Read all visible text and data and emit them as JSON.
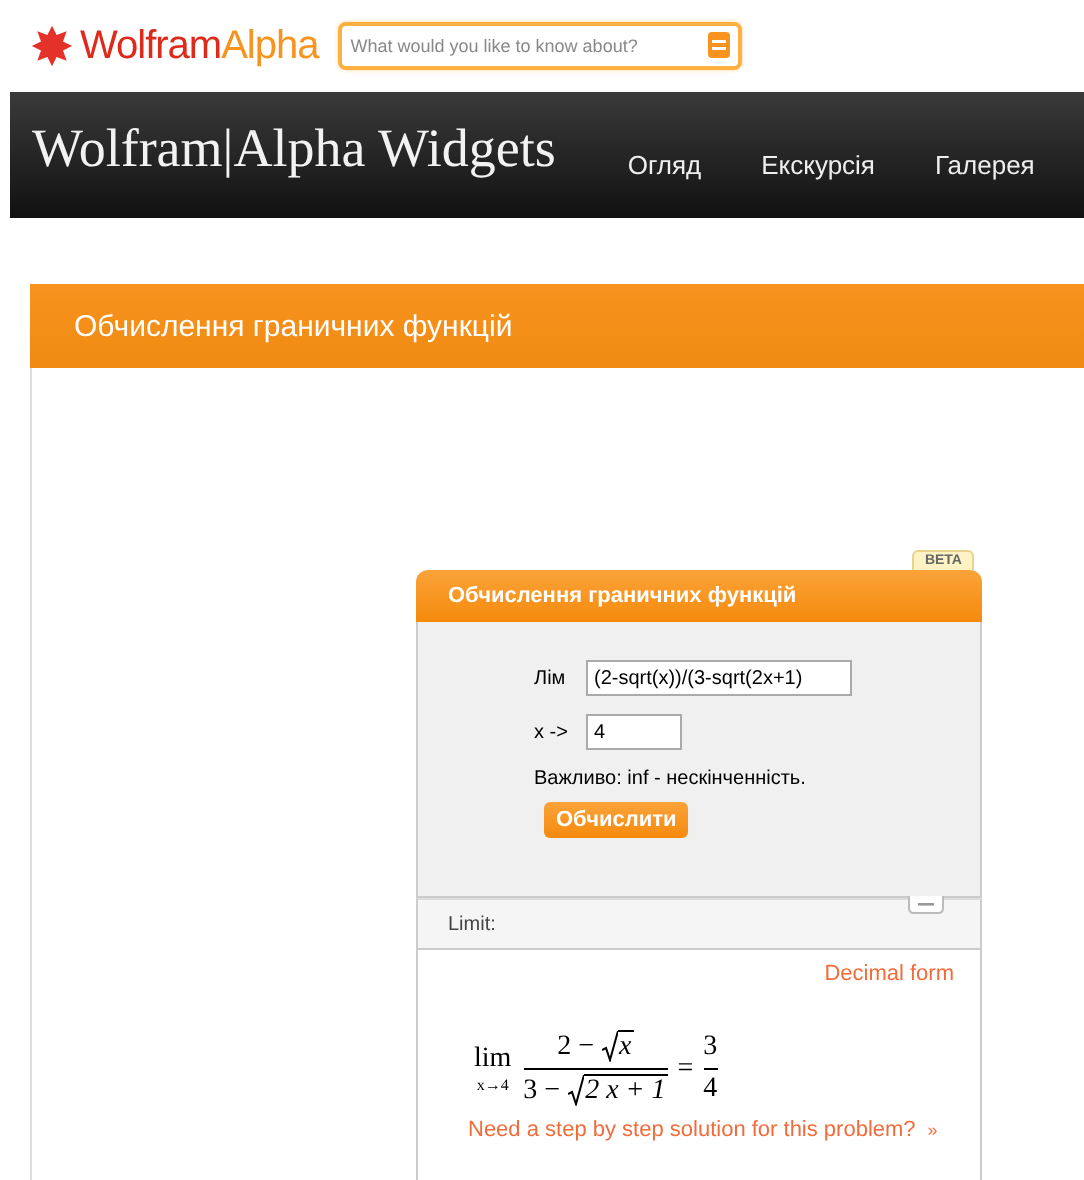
{
  "logo": {
    "part_1": "Wolfram",
    "part_2": "Alpha"
  },
  "search": {
    "placeholder": "What would you like to know about?"
  },
  "header": {
    "title": "Wolfram|Alpha Widgets",
    "nav": [
      "Огляд",
      "Екскурсія",
      "Галерея"
    ]
  },
  "page_title": "Обчислення граничних функцій",
  "widget": {
    "badge": "BETA",
    "title": "Обчислення граничних функцій",
    "fields": [
      {
        "label": "Лім",
        "value": "(2-sqrt(x))/(3-sqrt(2x+1)",
        "kind": "wide"
      },
      {
        "label": "x ->",
        "value": "4",
        "kind": "narrow"
      }
    ],
    "note": "Важливо: inf - нескінченність.",
    "button": "Обчислити",
    "result": {
      "heading": "Limit:",
      "link": "Decimal form",
      "formula": {
        "lim": "lim",
        "sub": "x→4",
        "num_a": "2 − ",
        "num_root": "x",
        "den_a": "3 − ",
        "den_root": "2 x + 1",
        "eq": "=",
        "frac_num": "3",
        "frac_den": "4"
      },
      "step_link": "Need a step by step solution for this problem?",
      "step_arrow": "»"
    }
  }
}
